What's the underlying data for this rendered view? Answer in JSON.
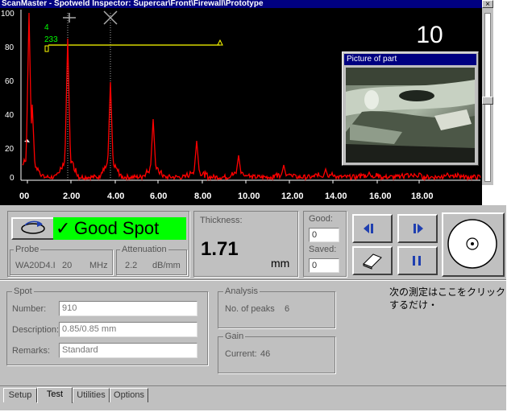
{
  "window": {
    "title": "ScanMaster - Spotweld Inspector: Supercar\\Front\\Firewall\\Prototype",
    "close_glyph": "×"
  },
  "plot": {
    "counter": "10",
    "y_ticks": [
      "100",
      "80",
      "60",
      "40",
      "20",
      "0"
    ],
    "x_ticks": [
      "00",
      "2.00",
      "4.00",
      "6.00",
      "8.00",
      "10.00",
      "12.00",
      "14.00",
      "16.00",
      "18.00"
    ],
    "gate_label_1": "4",
    "gate_label_2": "233",
    "picture_title": "Picture of part",
    "colors": {
      "trace": "#ff0000",
      "gate": "#ffff00",
      "gate_text": "#00ff00",
      "background": "#000000"
    }
  },
  "result": {
    "status": "Good Spot",
    "check_glyph": "✓",
    "status_color": "#00ff00",
    "probe_legend": "Probe",
    "probe_model": "WA20D4.I",
    "probe_freq": "20",
    "probe_unit": "MHz",
    "att_legend": "Attenuation",
    "att_value": "2.2",
    "att_unit": "dB/mm",
    "thickness_label": "Thickness:",
    "thickness_value": "1.71",
    "thickness_unit": "mm"
  },
  "counts": {
    "good_label": "Good:",
    "good_value": "0",
    "saved_label": "Saved:",
    "saved_value": "0"
  },
  "spot": {
    "legend": "Spot",
    "number_label": "Number:",
    "number_value": "910",
    "description_label": "Description:",
    "description_value": "0.85/0.85 mm",
    "remarks_label": "Remarks:",
    "remarks_value": "Standard"
  },
  "analysis": {
    "legend": "Analysis",
    "peaks_label": "No. of peaks",
    "peaks_value": "6"
  },
  "gain": {
    "legend": "Gain",
    "current_label": "Current:",
    "current_value": "46"
  },
  "tabs": [
    "Setup",
    "Test",
    "Utilities",
    "Options"
  ],
  "annotation": {
    "line1": "次の測定はここをクリック",
    "line2": "するだけ・"
  }
}
